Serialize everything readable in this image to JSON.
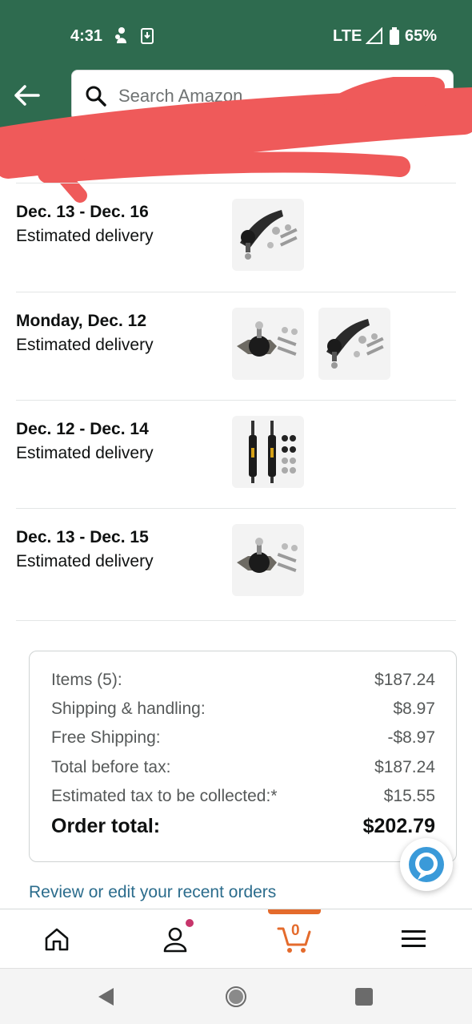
{
  "status_bar": {
    "time": "4:31",
    "network": "LTE",
    "battery": "65%"
  },
  "search": {
    "placeholder": "Search Amazon"
  },
  "deliveries": [
    {
      "date": "Dec. 13 - Dec. 16",
      "label": "Estimated delivery",
      "images": [
        "ball-joint-arm-kit"
      ]
    },
    {
      "date": "Monday, Dec. 12",
      "label": "Estimated delivery",
      "images": [
        "ball-joint-kit",
        "ball-joint-arm-kit"
      ]
    },
    {
      "date": "Dec. 12 - Dec. 14",
      "label": "Estimated delivery",
      "images": [
        "shock-absorber-pair"
      ]
    },
    {
      "date": "Dec. 13 - Dec. 15",
      "label": "Estimated delivery",
      "images": [
        "ball-joint-kit"
      ]
    }
  ],
  "summary": {
    "lines": [
      {
        "label": "Items (5):",
        "value": "$187.24"
      },
      {
        "label": "Shipping & handling:",
        "value": "$8.97"
      },
      {
        "label": "Free Shipping:",
        "value": "-$8.97"
      },
      {
        "label": "Total before tax:",
        "value": "$187.24"
      },
      {
        "label": "Estimated tax to be collected:*",
        "value": "$15.55"
      }
    ],
    "total": {
      "label": "Order total:",
      "value": "$202.79"
    }
  },
  "review_link": "Review or edit your recent orders",
  "bottom_nav": {
    "cart_count": "0"
  },
  "colors": {
    "header": "#2e6b4f",
    "link": "#2b6c8c",
    "cart_accent": "#e46b2c",
    "notification_dot": "#c7356b"
  }
}
